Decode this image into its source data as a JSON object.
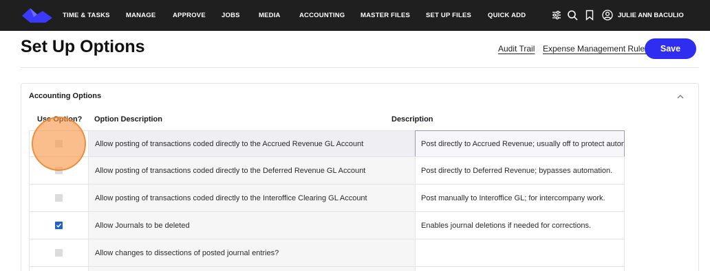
{
  "nav": {
    "items": [
      "TIME & TASKS",
      "MANAGE",
      "APPROVE",
      "JOBS",
      "MEDIA",
      "ACCOUNTING",
      "MASTER FILES",
      "SET UP FILES",
      "QUICK ADD"
    ],
    "user_name": "JULIE ANN BACULIO",
    "icons": [
      "sliders-icon",
      "search-icon",
      "bookmark-icon",
      "user-circle-icon"
    ]
  },
  "page": {
    "title": "Set Up Options",
    "audit_trail_label": "Audit Trail",
    "expense_rules_label": "Expense Management Rules",
    "save_label": "Save"
  },
  "panel": {
    "title": "Accounting Options",
    "headers": {
      "use_option": "Use Option?",
      "option_description": "Option Description",
      "description": "Description"
    },
    "rows": [
      {
        "checked": false,
        "option": "Allow posting of transactions coded directly to the Accrued Revenue GL Account",
        "description": "Post directly to Accrued Revenue; usually off to protect auton"
      },
      {
        "checked": false,
        "option": "Allow posting of transactions coded directly to the Deferred Revenue GL Account",
        "description": "Post directly to Deferred Revenue; bypasses automation."
      },
      {
        "checked": false,
        "option": "Allow posting of transactions coded directly to the Interoffice Clearing GL Account",
        "description": "Post manually to Interoffice GL; for intercompany work."
      },
      {
        "checked": true,
        "option": "Allow Journals to be deleted",
        "description": "Enables journal deletions if needed for corrections."
      },
      {
        "checked": false,
        "option": "Allow changes to dissections of posted journal entries?",
        "description": ""
      }
    ]
  },
  "colors": {
    "nav_bg": "#1f1f1f",
    "accent": "#2f2ef0",
    "logo": "#3a3aff",
    "checkbox_on": "#1f62c9",
    "cursor_highlight": "#f59646"
  }
}
